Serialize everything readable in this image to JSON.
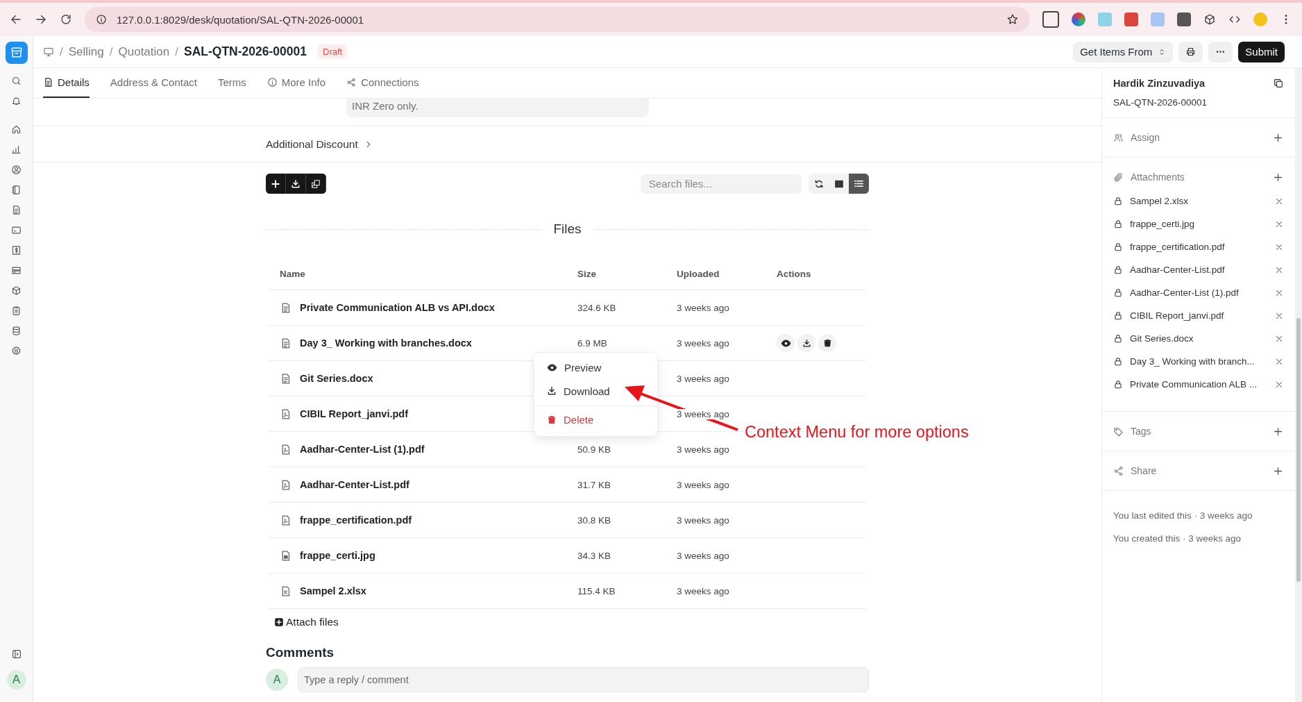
{
  "browser": {
    "url": "127.0.0.1:8029/desk/quotation/SAL-QTN-2026-00001"
  },
  "header": {
    "separator": "/",
    "breadcrumbs": [
      "Selling",
      "Quotation"
    ],
    "title": "SAL-QTN-2026-00001",
    "status": "Draft",
    "get_items": "Get Items From",
    "submit": "Submit"
  },
  "tabs": [
    {
      "label": "Details",
      "kind": "doc",
      "selected": true
    },
    {
      "label": "Address & Contact",
      "kind": "none",
      "selected": false
    },
    {
      "label": "Terms",
      "kind": "none",
      "selected": false
    },
    {
      "label": "More Info",
      "kind": "info",
      "selected": false
    },
    {
      "label": "Connections",
      "kind": "nodes",
      "selected": false
    }
  ],
  "in_words": "INR Zero only.",
  "section": "Additional Discount",
  "files": {
    "search_placeholder": "Search files...",
    "views": [
      {
        "kind": "refresh",
        "selected": false
      },
      {
        "kind": "grid",
        "selected": false
      },
      {
        "kind": "list",
        "selected": true
      }
    ],
    "heading": "Files",
    "columns": [
      "Name",
      "Size",
      "Uploaded",
      "Actions"
    ],
    "rows": [
      {
        "name": "Private Communication ALB vs API.docx",
        "kind": "doc",
        "size": "324.6 KB",
        "uploaded": "3 weeks ago",
        "show_actions": false
      },
      {
        "name": "Day 3_ Working with branches.docx",
        "kind": "doc",
        "size": "6.9 MB",
        "uploaded": "3 weeks ago",
        "show_actions": true
      },
      {
        "name": "Git Series.docx",
        "kind": "doc",
        "uploaded": "3 weeks ago",
        "show_actions": false
      },
      {
        "name": "CIBIL Report_janvi.pdf",
        "kind": "pdf",
        "uploaded": "3 weeks ago",
        "show_actions": false
      },
      {
        "name": "Aadhar-Center-List (1).pdf",
        "kind": "pdf",
        "size": "50.9 KB",
        "uploaded": "3 weeks ago",
        "show_actions": false
      },
      {
        "name": "Aadhar-Center-List.pdf",
        "kind": "pdf",
        "size": "31.7 KB",
        "uploaded": "3 weeks ago",
        "show_actions": false
      },
      {
        "name": "frappe_certification.pdf",
        "kind": "pdf",
        "size": "30.8 KB",
        "uploaded": "3 weeks ago",
        "show_actions": false
      },
      {
        "name": "frappe_certi.jpg",
        "kind": "image",
        "size": "34.3 KB",
        "uploaded": "3 weeks ago",
        "show_actions": false
      },
      {
        "name": "Sampel 2.xlsx",
        "kind": "sheet",
        "size": "115.4 KB",
        "uploaded": "3 weeks ago",
        "show_actions": false
      }
    ],
    "attach": "Attach files"
  },
  "context_menu": [
    {
      "label": "Preview",
      "kind": "preview"
    },
    {
      "label": "Download",
      "kind": "download"
    },
    {
      "label": "Delete",
      "kind": "delete"
    }
  ],
  "annotation": "Context Menu for more options",
  "comments": {
    "title": "Comments",
    "avatar": "A",
    "placeholder": "Type a reply / comment"
  },
  "sidebar": {
    "owner": "Hardik Zinzuvadiya",
    "doc_id": "SAL-QTN-2026-00001",
    "assign": "Assign",
    "attachments_label": "Attachments",
    "attachments": [
      "Sampel 2.xlsx",
      "frappe_certi.jpg",
      "frappe_certification.pdf",
      "Aadhar-Center-List.pdf",
      "Aadhar-Center-List (1).pdf",
      "CIBIL Report_janvi.pdf",
      "Git Series.docx",
      "Day 3_ Working with branch...",
      "Private Communication ALB ..."
    ],
    "tags": "Tags",
    "share": "Share",
    "activity": [
      "You last edited this · 3 weeks ago",
      "You created this · 3 weeks ago"
    ]
  },
  "user_avatar": "A"
}
